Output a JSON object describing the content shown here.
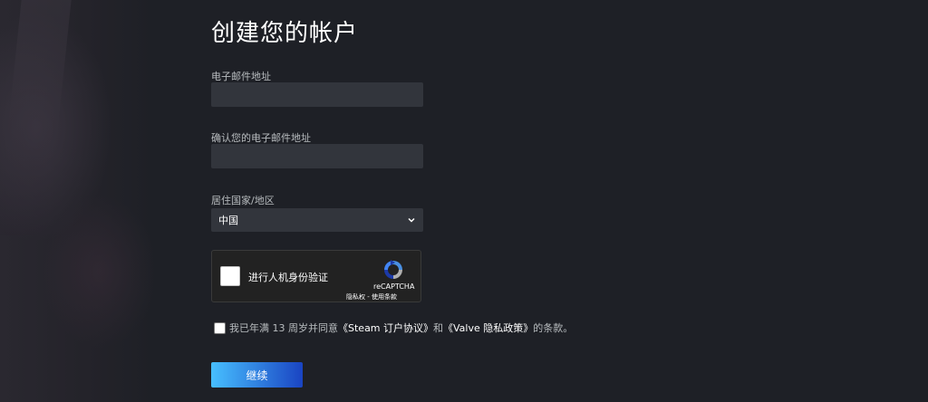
{
  "title": "创建您的帐户",
  "email": {
    "label": "电子邮件地址",
    "value": ""
  },
  "confirm_email": {
    "label": "确认您的电子邮件地址",
    "value": ""
  },
  "country": {
    "label": "居住国家/地区",
    "selected": "中国"
  },
  "captcha": {
    "label": "进行人机身份验证",
    "brand": "reCAPTCHA",
    "privacy": "隐私权",
    "separator": "-",
    "terms": "使用条款"
  },
  "agreement": {
    "prefix": "我已年满 13 周岁并同意",
    "steam_link": "《Steam 订户协议》",
    "middle": "和",
    "valve_link": "《Valve 隐私政策》",
    "suffix": "的条款。"
  },
  "continue_label": "继续",
  "colors": {
    "background": "#1e2026",
    "input_bg": "#32353c",
    "button_gradient_start": "#47bfff",
    "button_gradient_end": "#1a44c2"
  }
}
